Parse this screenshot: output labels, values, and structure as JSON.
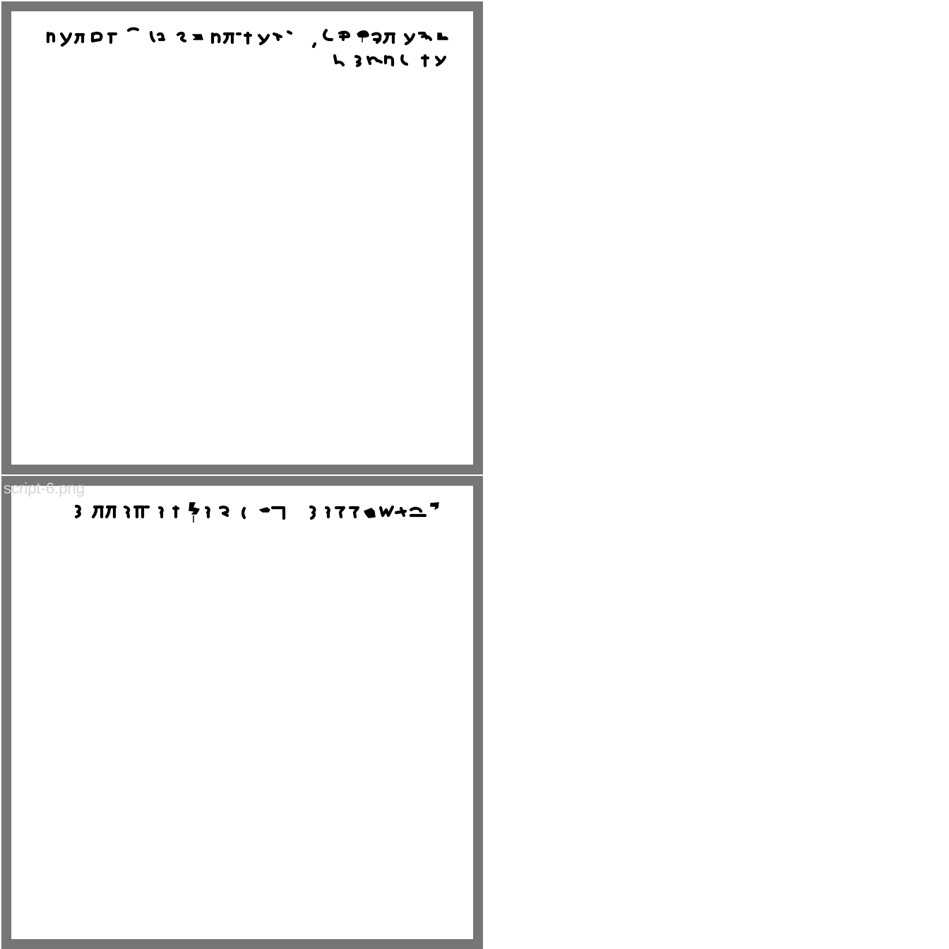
{
  "panels": [
    {
      "label": "",
      "lines": 2
    },
    {
      "label": "script-6.png",
      "lines": 1
    }
  ],
  "colors": {
    "frame": "#767676",
    "page": "#ffffff",
    "ink": "#000000",
    "label": "#d6d6d6"
  }
}
